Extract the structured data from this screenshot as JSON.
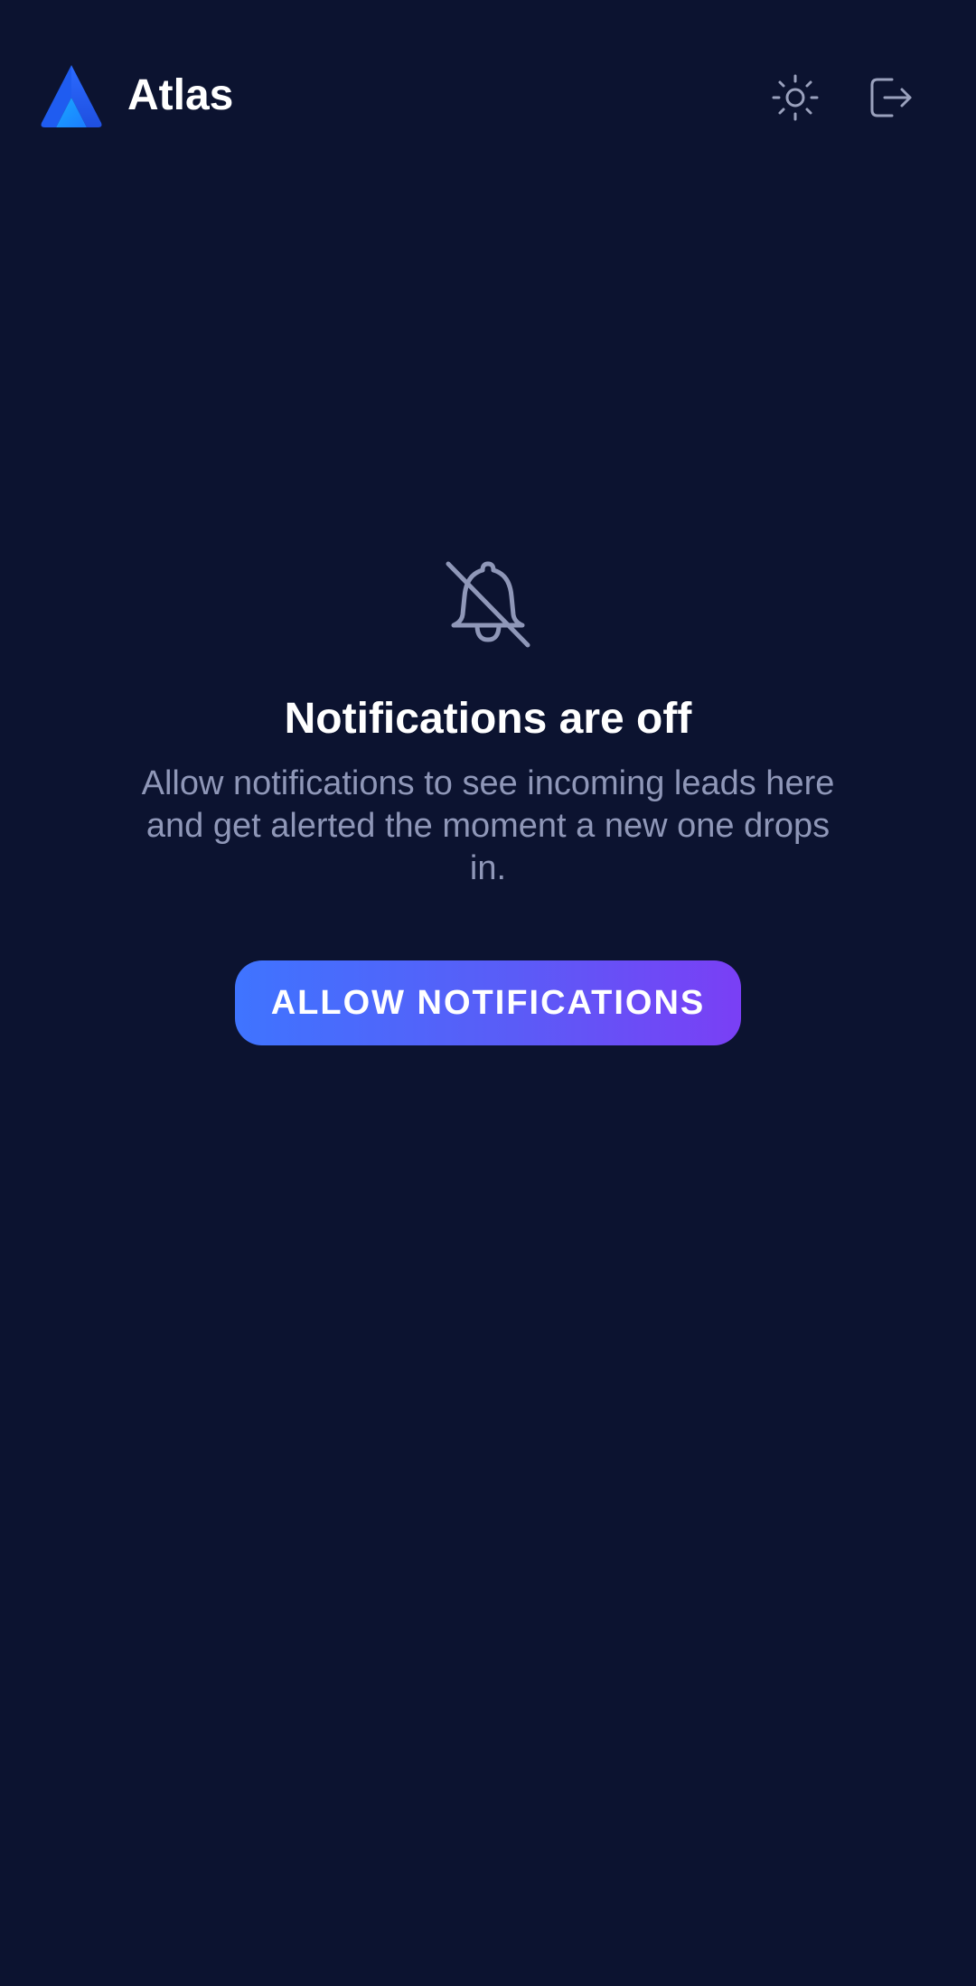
{
  "header": {
    "app_title": "Atlas",
    "logo_icon": "atlas-triangle-logo",
    "theme_toggle_icon": "sun-icon",
    "logout_icon": "logout-icon"
  },
  "empty_state": {
    "icon": "bell-off-icon",
    "title": "Notifications are off",
    "message": "Allow notifications to see incoming leads here and get alerted the moment a new one drops in.",
    "button_label": "ALLOW NOTIFICATIONS"
  },
  "colors": {
    "background": "#0c1330",
    "text_primary": "#ffffff",
    "text_secondary": "#8f97b8",
    "icon_muted": "#9aa1bd",
    "button_gradient_start": "#3f74ff",
    "button_gradient_end": "#7a3ff5"
  }
}
